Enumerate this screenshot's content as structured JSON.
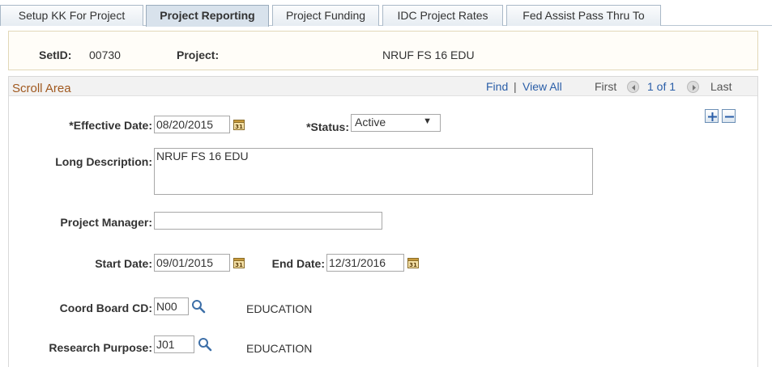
{
  "tabs": [
    {
      "label": "Setup KK For Project",
      "active": false
    },
    {
      "label": "Project Reporting",
      "active": true
    },
    {
      "label": "Project Funding",
      "active": false
    },
    {
      "label": "IDC Project Rates",
      "active": false
    },
    {
      "label": "Fed Assist Pass Thru To",
      "active": false
    }
  ],
  "key": {
    "setid_label": "SetID:",
    "setid_value": "00730",
    "project_label": "Project:",
    "project_value": "NRUF FS 16 EDU"
  },
  "scroll_area": {
    "title": "Scroll Area",
    "find_label": "Find",
    "separator": "|",
    "view_all_label": "View All",
    "first_label": "First",
    "count": "1 of 1",
    "last_label": "Last"
  },
  "form": {
    "effective_date_label": "*Effective Date:",
    "effective_date_value": "08/20/2015",
    "status_label": "*Status:",
    "status_value": "Active",
    "long_description_label": "Long Description:",
    "long_description_value": "NRUF FS 16 EDU",
    "project_manager_label": "Project Manager:",
    "project_manager_value": "",
    "start_date_label": "Start Date:",
    "start_date_value": "09/01/2015",
    "end_date_label": "End Date:",
    "end_date_value": "12/31/2016",
    "coord_board_label": "Coord Board CD:",
    "coord_board_value": "N00",
    "coord_board_desc": "EDUCATION",
    "research_purpose_label": "Research Purpose:",
    "research_purpose_value": "J01",
    "research_purpose_desc": "EDUCATION"
  },
  "colors": {
    "scroll_title": "#a0581e",
    "link": "#2a5ea8",
    "keybox_border": "#e2d8b8"
  }
}
